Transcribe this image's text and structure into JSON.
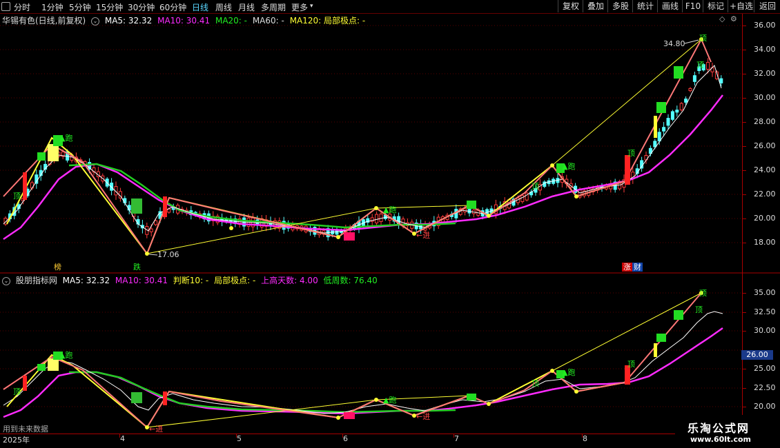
{
  "toolbar": {
    "periods": [
      "分时",
      "1分钟",
      "5分钟",
      "15分钟",
      "30分钟",
      "60分钟",
      "日线",
      "周线",
      "月线",
      "多周期",
      "更多"
    ],
    "active": "日线",
    "right_buttons": [
      "复权",
      "叠加",
      "多股",
      "统计",
      "画线",
      "F10",
      "标记",
      "+自选",
      "返回"
    ]
  },
  "main_chart": {
    "title": "华锡有色(日线,前复权)",
    "ma5": "MA5: 32.32",
    "ma10": "MA10: 30.41",
    "ma20": "MA20: -",
    "ma60": "MA60: -",
    "ma120": "MA120: 局部极点: -",
    "high_label": "34.80",
    "low_label": "17.06",
    "y_ticks": [
      "36.00",
      "34.00",
      "32.00",
      "30.00",
      "28.00",
      "26.00",
      "24.00",
      "22.00",
      "20.00",
      "18.00"
    ],
    "signals": {
      "pao1": "跑",
      "pao2": "跑",
      "pao3": "跑",
      "jin": "进",
      "ding1": "顶",
      "ding2": "顶",
      "ding3": "顶",
      "ding4": "顶",
      "ding5": "顶"
    },
    "bottom_tags": {
      "bang": "榜",
      "die": "跌",
      "zhang": "涨",
      "cai": "财"
    },
    "colors": {
      "up": "#ff3b3b",
      "down": "#54ffff",
      "ma5": "#ffffff",
      "ma10": "#ff2bff",
      "ma20": "#22cc22",
      "zigzag": "#ffff33",
      "trend_up": "#ff7777"
    }
  },
  "indicator_chart": {
    "title": "股朋指标网",
    "ma5": "MA5: 32.32",
    "ma10": "MA10: 30.41",
    "judge": "判断10: -",
    "extreme": "局部极点: -",
    "up_days": "上高天数: 4.00",
    "low_weeks": "低周数: 76.40",
    "y_ticks": [
      "35.00",
      "32.50",
      "30.00",
      "27.50",
      "25.00",
      "22.50",
      "20.00"
    ],
    "price_box": "26.00",
    "signals": {
      "pao1": "跑",
      "pao2": "跑",
      "pao3": "跑",
      "jin1": "进",
      "jin2": "进",
      "ding1": "顶",
      "ding2": "顶",
      "ding3": "顶",
      "ding4": "顶"
    }
  },
  "x_axis": {
    "labels": [
      "2025年",
      "4",
      "5",
      "6",
      "7",
      "8"
    ]
  },
  "footer": {
    "future_note": "用到未来数据",
    "site_name": "乐淘公式网",
    "site_url": "www.60lt.com"
  }
}
